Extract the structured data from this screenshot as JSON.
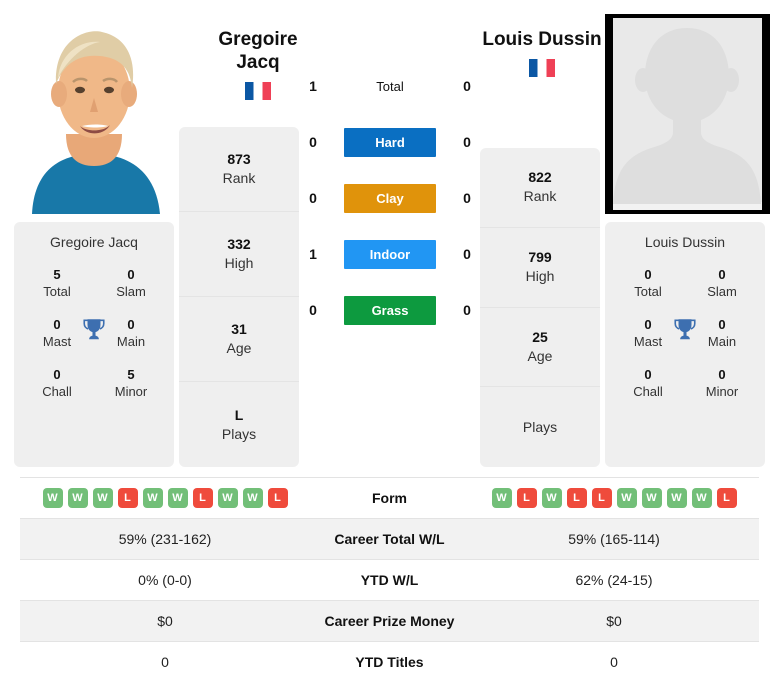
{
  "players": {
    "left": {
      "name_line1": "Gregoire",
      "name_line2": "Jacq",
      "full_name": "Gregoire Jacq",
      "country_flag": "france-flag",
      "photo": "player-photo",
      "titles": {
        "total": "5",
        "total_label": "Total",
        "slam": "0",
        "slam_label": "Slam",
        "mast": "0",
        "mast_label": "Mast",
        "main": "0",
        "main_label": "Main",
        "chall": "0",
        "chall_label": "Chall",
        "minor": "5",
        "minor_label": "Minor"
      },
      "stats": [
        {
          "value": "873",
          "label": "Rank"
        },
        {
          "value": "332",
          "label": "High"
        },
        {
          "value": "31",
          "label": "Age"
        },
        {
          "value": "L",
          "label": "Plays"
        }
      ],
      "form": [
        "W",
        "W",
        "W",
        "L",
        "W",
        "W",
        "L",
        "W",
        "W",
        "L"
      ],
      "career_total_wl": "59% (231-162)",
      "ytd_wl": "0% (0-0)",
      "career_prize_money": "$0",
      "ytd_titles": "0"
    },
    "right": {
      "name_line1": "Louis Dussin",
      "name_line2": "",
      "full_name": "Louis Dussin",
      "country_flag": "france-flag",
      "photo": "placeholder-avatar",
      "titles": {
        "total": "0",
        "total_label": "Total",
        "slam": "0",
        "slam_label": "Slam",
        "mast": "0",
        "mast_label": "Mast",
        "main": "0",
        "main_label": "Main",
        "chall": "0",
        "chall_label": "Chall",
        "minor": "0",
        "minor_label": "Minor"
      },
      "stats": [
        {
          "value": "822",
          "label": "Rank"
        },
        {
          "value": "799",
          "label": "High"
        },
        {
          "value": "25",
          "label": "Age"
        },
        {
          "value": "",
          "label": "Plays"
        }
      ],
      "form": [
        "W",
        "L",
        "W",
        "L",
        "L",
        "W",
        "W",
        "W",
        "W",
        "L"
      ],
      "career_total_wl": "59% (165-114)",
      "ytd_wl": "62% (24-15)",
      "career_prize_money": "$0",
      "ytd_titles": "0"
    }
  },
  "surfaces": [
    {
      "label": "Total",
      "left": "1",
      "right": "0",
      "color": ""
    },
    {
      "label": "Hard",
      "left": "0",
      "right": "0",
      "color": "#0a6fc2"
    },
    {
      "label": "Clay",
      "left": "0",
      "right": "0",
      "color": "#e0930b"
    },
    {
      "label": "Indoor",
      "left": "1",
      "right": "0",
      "color": "#2196f3"
    },
    {
      "label": "Grass",
      "left": "0",
      "right": "0",
      "color": "#0d9a3f"
    }
  ],
  "table_rows": [
    {
      "label": "Form"
    },
    {
      "label": "Career Total W/L"
    },
    {
      "label": "YTD W/L"
    },
    {
      "label": "Career Prize Money"
    },
    {
      "label": "YTD Titles"
    }
  ],
  "colors": {
    "win_badge": "#72bf78",
    "loss_badge": "#ef4b3c",
    "card_bg": "#efefef",
    "row_alt_bg": "#f2f2f2",
    "trophy": "#3d6fb0"
  }
}
